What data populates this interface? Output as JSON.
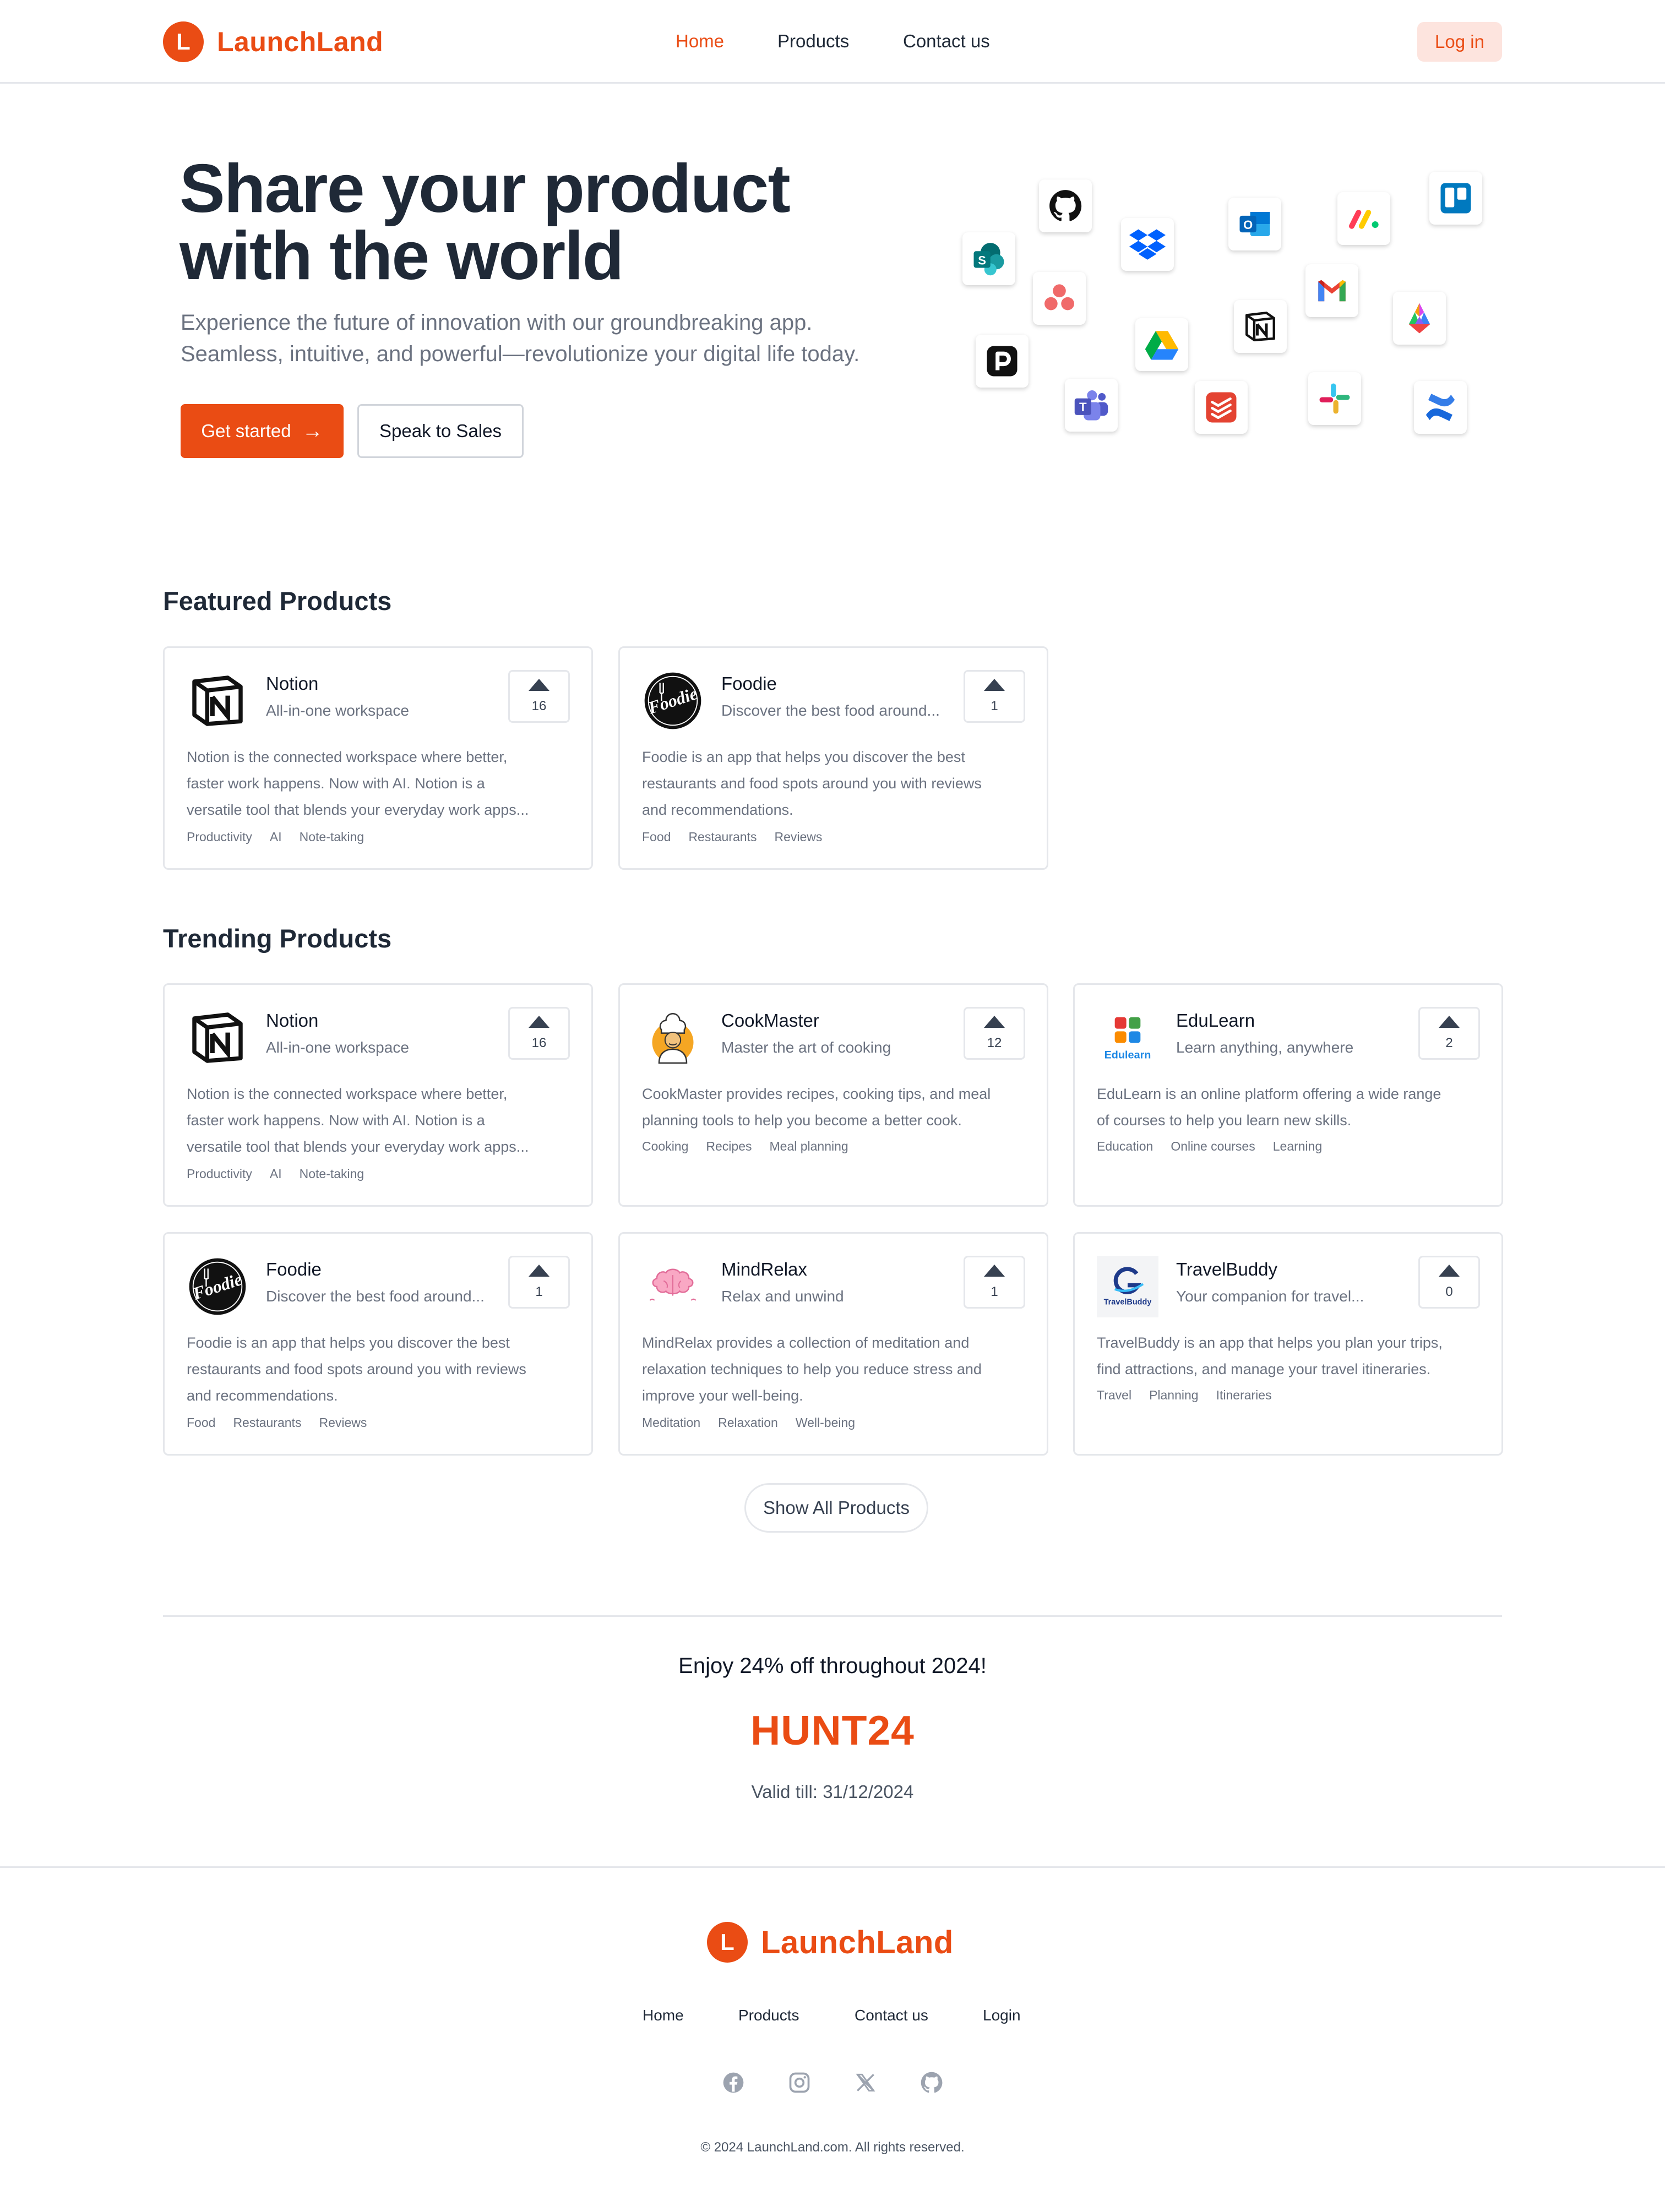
{
  "brand": {
    "logo_letter": "L",
    "name": "LaunchLand",
    "accent": "#ea4c14"
  },
  "nav": {
    "home": "Home",
    "products": "Products",
    "contact": "Contact us",
    "login": "Log in"
  },
  "hero": {
    "title_line1": "Share your product",
    "title_line2": "with the world",
    "subtitle_line1": "Experience the future of innovation with our groundbreaking app.",
    "subtitle_line2": "Seamless, intuitive, and powerful—revolutionize your digital life today.",
    "cta_primary": "Get started",
    "cta_primary_icon": "arrow-right-icon",
    "cta_secondary": "Speak to Sales",
    "app_icons": [
      "github",
      "dropbox",
      "outlook",
      "monday",
      "trello",
      "sharepoint",
      "asana",
      "notion",
      "gmail",
      "copilot",
      "google-drive",
      "pocket",
      "teams",
      "todoist",
      "slack",
      "confluence"
    ]
  },
  "featured": {
    "title": "Featured Products",
    "items": [
      {
        "name": "Notion",
        "tagline": "All-in-one workspace",
        "votes": "16",
        "logo": "notion-logo",
        "desc": [
          "Notion is the connected workspace where better,",
          "faster work happens. Now with AI. Notion is a",
          "versatile tool that blends your everyday work apps..."
        ],
        "tags": [
          "Productivity",
          "AI",
          "Note-taking"
        ]
      },
      {
        "name": "Foodie",
        "tagline": "Discover the best food around...",
        "votes": "1",
        "logo": "foodie-logo",
        "desc": [
          "Foodie is an app that helps you discover the best",
          "restaurants and food spots around you with reviews",
          "and recommendations."
        ],
        "tags": [
          "Food",
          "Restaurants",
          "Reviews"
        ]
      }
    ]
  },
  "trending": {
    "title": "Trending Products",
    "items": [
      {
        "name": "Notion",
        "tagline": "All-in-one workspace",
        "votes": "16",
        "logo": "notion-logo",
        "desc": [
          "Notion is the connected workspace where better,",
          "faster work happens. Now with AI. Notion is a",
          "versatile tool that blends your everyday work apps..."
        ],
        "tags": [
          "Productivity",
          "AI",
          "Note-taking"
        ]
      },
      {
        "name": "CookMaster",
        "tagline": "Master the art of cooking",
        "votes": "12",
        "logo": "chef-logo",
        "desc": [
          "CookMaster provides recipes, cooking tips, and meal",
          "planning tools to help you become a better cook."
        ],
        "tags": [
          "Cooking",
          "Recipes",
          "Meal planning"
        ]
      },
      {
        "name": "EduLearn",
        "tagline": "Learn anything, anywhere",
        "votes": "2",
        "logo": "edulearn-logo",
        "logo_text": "Edulearn",
        "desc": [
          "EduLearn is an online platform offering a wide range",
          "of courses to help you learn new skills."
        ],
        "tags": [
          "Education",
          "Online courses",
          "Learning"
        ]
      },
      {
        "name": "Foodie",
        "tagline": "Discover the best food around...",
        "votes": "1",
        "logo": "foodie-logo",
        "desc": [
          "Foodie is an app that helps you discover the best",
          "restaurants and food spots around you with reviews",
          "and recommendations."
        ],
        "tags": [
          "Food",
          "Restaurants",
          "Reviews"
        ]
      },
      {
        "name": "MindRelax",
        "tagline": "Relax and unwind",
        "votes": "1",
        "logo": "brain-logo",
        "desc": [
          "MindRelax provides a collection of meditation and",
          "relaxation techniques to help you reduce stress and",
          "improve your well-being."
        ],
        "tags": [
          "Meditation",
          "Relaxation",
          "Well-being"
        ]
      },
      {
        "name": "TravelBuddy",
        "tagline": "Your companion for travel...",
        "votes": "0",
        "logo": "travelbuddy-logo",
        "logo_text": "TravelBuddy",
        "desc": [
          "TravelBuddy is an app that helps you plan your trips,",
          "find attractions, and manage your travel itineraries."
        ],
        "tags": [
          "Travel",
          "Planning",
          "Itineraries"
        ]
      }
    ]
  },
  "show_all": "Show All Products",
  "promo": {
    "text": "Enjoy 24% off throughout 2024!",
    "code": "HUNT24",
    "valid": "Valid till: 31/12/2024"
  },
  "footer": {
    "nav": {
      "home": "Home",
      "products": "Products",
      "contact": "Contact us",
      "login": "Login"
    },
    "social": [
      "facebook-icon",
      "instagram-icon",
      "x-icon",
      "github-icon"
    ],
    "copyright": "© 2024 LaunchLand.com. All rights reserved."
  }
}
